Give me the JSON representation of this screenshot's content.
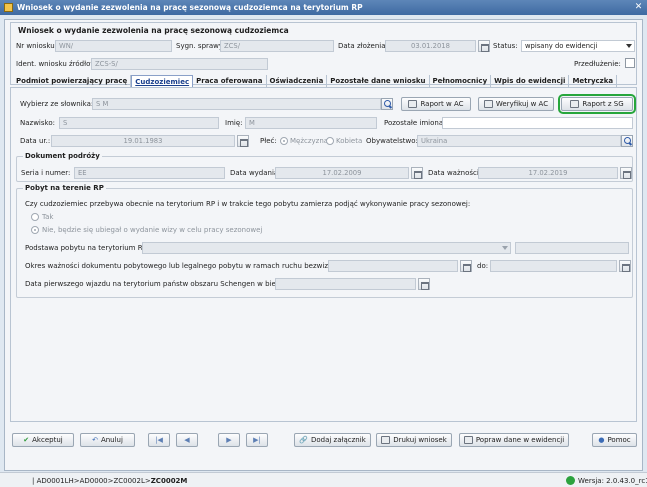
{
  "window": {
    "title": "Wniosek o wydanie zezwolenia na pracę sezonową cudzoziemca na terytorium RP",
    "close": "✕"
  },
  "header": {
    "caption": "Wniosek o wydanie zezwolenia na pracę sezonową cudzoziemca",
    "nr_label": "Nr wniosku:",
    "nr_value": "WN/",
    "sygn_label": "Sygn. sprawy:",
    "sygn_value": "ZCS/",
    "data_label": "Data złożenia:",
    "data_value": "03.01.2018",
    "status_label": "Status:",
    "status_value": "wpisany do ewidencji",
    "ident_label": "Ident. wniosku źródłowego:",
    "ident_value": "ZCS-S/",
    "przedl_label": "Przedłużenie:"
  },
  "tabs": [
    "Podmiot powierzający pracę",
    "Cudzoziemiec",
    "Praca oferowana",
    "Oświadczenia",
    "Pozostałe dane wniosku",
    "Pełnomocnicy",
    "Wpis do ewidencji",
    "Metryczka"
  ],
  "panel": {
    "slownik_label": "Wybierz ze słownika:",
    "slownik_value": "S          M",
    "raport_ac": "Raport w AC",
    "weryfikuj_ac": "Weryfikuj w AC",
    "raport_sg": "Raport z SG",
    "nazwisko_label": "Nazwisko:",
    "nazwisko_value": "S",
    "imie_label": "Imię:",
    "imie_value": "M",
    "pozostale_label": "Pozostałe imiona:",
    "pozostale_value": "",
    "dataur_label": "Data ur.:",
    "dataur_value": "19.01.1983",
    "plec_label": "Płeć:",
    "plec_m": "Mężczyzna",
    "plec_k": "Kobieta",
    "obyw_label": "Obywatelstwo:",
    "obyw_value": "Ukraina",
    "dok_caption": "Dokument podróży",
    "seria_label": "Seria i numer:",
    "seria_value": "EE",
    "wyd_label": "Data wydania:",
    "wyd_value": "17.02.2009",
    "waz_label": "Data ważności:",
    "waz_value": "17.02.2019",
    "pobyt_caption": "Pobyt na terenie RP",
    "pobyt_question": "Czy cudzoziemiec przebywa obecnie na terytorium RP i w trakcie tego pobytu zamierza podjąć wykonywanie pracy sezonowej:",
    "tak": "Tak",
    "nie": "Nie, będzie się ubiegał o wydanie wizy w celu pracy sezonowej",
    "podstawa_label": "Podstawa pobytu na terytorium RP:",
    "okres_label": "Okres ważności dokumentu pobytowego lub legalnego pobytu w ramach ruchu bezwizowego od:",
    "do_label": "do:",
    "pierwszy_label": "Data pierwszego wjazdu na terytorium państw obszaru Schengen w bież. roku:"
  },
  "footer": {
    "akceptuj": "Akceptuj",
    "anuluj": "Anuluj",
    "dodaj": "Dodaj załącznik",
    "drukuj": "Drukuj wniosek",
    "popraw": "Popraw dane w ewidencji",
    "pomoc": "Pomoc"
  },
  "statusbar": {
    "path_prefix": "| AD0001LH>AD0000>ZC0002L>",
    "path_current": "ZC0002M",
    "version": "Wersja: 2.0.43.0_rc1"
  }
}
